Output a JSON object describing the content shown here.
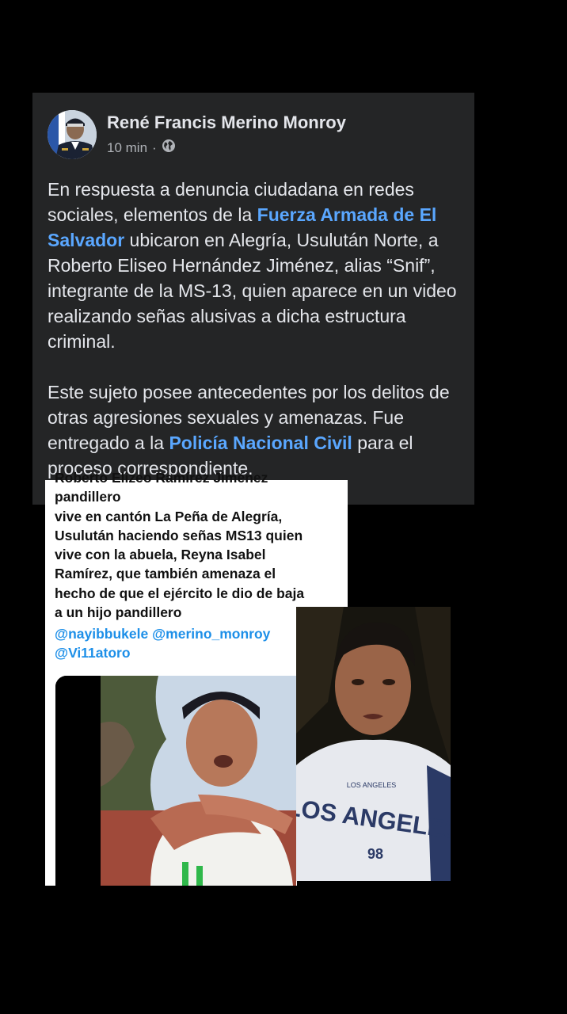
{
  "post": {
    "author": "René Francis Merino Monroy",
    "time": "10 min",
    "separator": "·",
    "audience_icon": "globe-icon",
    "paragraph1": [
      {
        "text": "En respuesta a denuncia ciudadana en redes sociales, elementos de la ",
        "link": false
      },
      {
        "text": "Fuerza Armada de El Salvador",
        "link": true
      },
      {
        "text": " ubicaron en Alegría, Usulután Norte, a Roberto Eliseo Hernández Jiménez, alias “Snif”, integrante de la MS-13, quien aparece en un video realizando señas alusivas a dicha estructura criminal.",
        "link": false
      }
    ],
    "paragraph2": [
      {
        "text": "Este sujeto posee antecedentes por los delitos de otras agresiones sexuales y amenazas. Fue entregado a la ",
        "link": false
      },
      {
        "text": "Policía Nacional Civil",
        "link": true
      },
      {
        "text": " para el proceso correspondiente.",
        "link": false
      }
    ]
  },
  "tweet": {
    "lines": [
      "Roberto Elizeo Ramírez Jiménez",
      "pandillero",
      "vive en cantón La Peña de Alegría,",
      "Usulután haciendo señas MS13 quien",
      "vive con la abuela, Reyna Isabel",
      "Ramírez, que también amenaza el",
      "hecho de que el ejército le dio de baja",
      "a un hijo pandillero"
    ],
    "mentions": [
      "@nayibbukele",
      "@merino_monroy",
      "@Vi11atoro"
    ]
  },
  "photo": {
    "shirt_top": "LOS ANGELES",
    "shirt_main": "LOS ANGELES",
    "shirt_number": "98"
  },
  "colors": {
    "background": "#000000",
    "card": "#242526",
    "text": "#e4e6eb",
    "meta": "#b0b3b8",
    "link": "#5aa7ff",
    "mention": "#1d8fe8"
  }
}
